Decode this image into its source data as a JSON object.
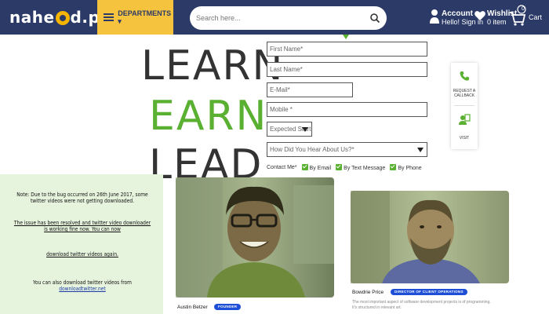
{
  "header": {
    "logo": "nahe",
    "logo_rest": "d.pk",
    "departments_label": "DEPARTMENTS ▾",
    "search_placeholder": "Search here...",
    "account_title": "Account",
    "account_sub": "Hello! Sign in",
    "wishlist_title": "Wishlist",
    "wishlist_sub": "0 item",
    "cart_label": "Cart",
    "cart_count": "0"
  },
  "hero": {
    "line1": "LEARN",
    "line2": "EARN",
    "line3": "LEAD"
  },
  "form": {
    "first_name": "First Name*",
    "last_name": "Last Name*",
    "email": "E-Mail*",
    "mobile": "Mobile *",
    "expected_start": "Expected Start Y",
    "heard_about": "How Did You Hear About Us?*",
    "contact_me": "Contact Me*",
    "by_email": "By Email",
    "by_text": "By Text Message",
    "by_phone": "By Phone"
  },
  "side_actions": {
    "request_line1": "REQUEST A",
    "request_line2": "CALLBACK",
    "visit": "VISIT"
  },
  "notice": {
    "line1": "Note: Due to the bug occurred on 26th June 2017, some twitter videos were not getting downloaded.",
    "line2": "The issue has been resolved and twitter video downloader is working fine now. You can now",
    "line3": "download twitter videos again.",
    "line4a": "You can also download twitter videos from ",
    "line4b": "downloadtwitter.net"
  },
  "people": [
    {
      "name": "Austin Betzer",
      "role": "FOUNDER",
      "desc": ""
    },
    {
      "name": "Bowdrie Price",
      "role": "DIRECTOR OF CLIENT OPERATIONS",
      "desc": "The most important aspect of software development projects is of programming. It's structured in relevant art."
    }
  ],
  "colors": {
    "header_bg": "#2b3a67",
    "departments_bg": "#f6c33f",
    "accent_green": "#5ab031",
    "notice_bg": "#e7f4dd",
    "badge_blue": "#1e4fd6"
  }
}
